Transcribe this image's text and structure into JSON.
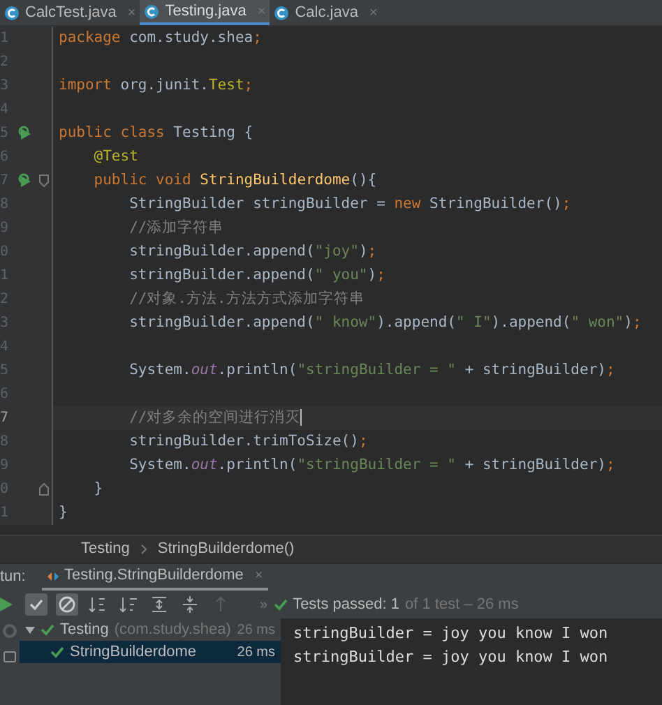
{
  "tabs": [
    {
      "label": "CalcTest.java",
      "close": "×",
      "selected": false
    },
    {
      "label": "Testing.java",
      "close": "×",
      "selected": true
    },
    {
      "label": "Calc.java",
      "close": "×",
      "selected": false
    }
  ],
  "editor": {
    "lines": [
      {
        "number": "1",
        "current": false,
        "run_marker": false,
        "fold_start": false,
        "fold_end": false,
        "tokens": [
          {
            "kind": "keyword",
            "text": "package"
          },
          {
            "kind": "plain",
            "text": " com.study.shea"
          },
          {
            "kind": "keyword",
            "text": ";"
          }
        ]
      },
      {
        "number": "2",
        "current": false,
        "run_marker": false,
        "fold_start": false,
        "fold_end": false
      },
      {
        "number": "3",
        "current": false,
        "run_marker": false,
        "fold_start": false,
        "fold_end": false,
        "tokens": [
          {
            "kind": "keyword",
            "text": "import"
          },
          {
            "kind": "plain",
            "text": " org.junit."
          },
          {
            "kind": "annotation",
            "text": "Test"
          },
          {
            "kind": "keyword",
            "text": ";"
          }
        ]
      },
      {
        "number": "4",
        "current": false,
        "run_marker": false,
        "fold_start": false,
        "fold_end": false
      },
      {
        "number": "5",
        "current": false,
        "run_marker": true,
        "fold_start": false,
        "fold_end": false,
        "tokens": [
          {
            "kind": "keyword",
            "text": "public class"
          },
          {
            "kind": "plain",
            "text": " Testing {"
          }
        ]
      },
      {
        "number": "6",
        "current": false,
        "run_marker": false,
        "fold_start": false,
        "fold_end": false,
        "tokens": [
          {
            "kind": "annotation",
            "text": "    @Test"
          }
        ]
      },
      {
        "number": "7",
        "current": false,
        "run_marker": true,
        "fold_start": true,
        "fold_end": false,
        "tokens": [
          {
            "kind": "keyword",
            "text": "    public void "
          },
          {
            "kind": "method",
            "text": "StringBuilderdome"
          },
          {
            "kind": "plain",
            "text": "(){"
          }
        ]
      },
      {
        "number": "8",
        "current": false,
        "run_marker": false,
        "fold_start": false,
        "fold_end": false,
        "tokens": [
          {
            "kind": "plain",
            "text": "        StringBuilder stringBuilder = "
          },
          {
            "kind": "keyword",
            "text": "new"
          },
          {
            "kind": "plain",
            "text": " StringBuilder()"
          },
          {
            "kind": "keyword",
            "text": ";"
          }
        ]
      },
      {
        "number": "9",
        "current": false,
        "run_marker": false,
        "fold_start": false,
        "fold_end": false,
        "tokens": [
          {
            "kind": "comment",
            "text": "        //添加字符串"
          }
        ]
      },
      {
        "number": "0",
        "current": false,
        "run_marker": false,
        "fold_start": false,
        "fold_end": false,
        "tokens": [
          {
            "kind": "plain",
            "text": "        stringBuilder.append("
          },
          {
            "kind": "string",
            "text": "\"joy\""
          },
          {
            "kind": "plain",
            "text": ")"
          },
          {
            "kind": "keyword",
            "text": ";"
          }
        ]
      },
      {
        "number": "1",
        "current": false,
        "run_marker": false,
        "fold_start": false,
        "fold_end": false,
        "tokens": [
          {
            "kind": "plain",
            "text": "        stringBuilder.append("
          },
          {
            "kind": "string",
            "text": "\" you\""
          },
          {
            "kind": "plain",
            "text": ")"
          },
          {
            "kind": "keyword",
            "text": ";"
          }
        ]
      },
      {
        "number": "2",
        "current": false,
        "run_marker": false,
        "fold_start": false,
        "fold_end": false,
        "tokens": [
          {
            "kind": "comment",
            "text": "        //对象.方法.方法方式添加字符串"
          }
        ]
      },
      {
        "number": "3",
        "current": false,
        "run_marker": false,
        "fold_start": false,
        "fold_end": false,
        "tokens": [
          {
            "kind": "plain",
            "text": "        stringBuilder.append("
          },
          {
            "kind": "string",
            "text": "\" know\""
          },
          {
            "kind": "plain",
            "text": ").append("
          },
          {
            "kind": "string",
            "text": "\" I\""
          },
          {
            "kind": "plain",
            "text": ").append("
          },
          {
            "kind": "string",
            "text": "\" won\""
          },
          {
            "kind": "plain",
            "text": ")"
          },
          {
            "kind": "keyword",
            "text": ";"
          }
        ]
      },
      {
        "number": "4",
        "current": false,
        "run_marker": false,
        "fold_start": false,
        "fold_end": false
      },
      {
        "number": "5",
        "current": false,
        "run_marker": false,
        "fold_start": false,
        "fold_end": false,
        "tokens": [
          {
            "kind": "plain",
            "text": "        System."
          },
          {
            "kind": "field",
            "text": "out"
          },
          {
            "kind": "plain",
            "text": ".println("
          },
          {
            "kind": "string",
            "text": "\"stringBuilder = \""
          },
          {
            "kind": "plain",
            "text": " + stringBuilder)"
          },
          {
            "kind": "keyword",
            "text": ";"
          }
        ]
      },
      {
        "number": "6",
        "current": false,
        "run_marker": false,
        "fold_start": false,
        "fold_end": false
      },
      {
        "number": "7",
        "current": true,
        "run_marker": false,
        "fold_start": false,
        "fold_end": false,
        "tokens": [
          {
            "kind": "comment",
            "text": "        //对多余的空间进行消灭"
          }
        ]
      },
      {
        "number": "8",
        "current": false,
        "run_marker": false,
        "fold_start": false,
        "fold_end": false,
        "tokens": [
          {
            "kind": "plain",
            "text": "        stringBuilder.trimToSize()"
          },
          {
            "kind": "keyword",
            "text": ";"
          }
        ]
      },
      {
        "number": "9",
        "current": false,
        "run_marker": false,
        "fold_start": false,
        "fold_end": false,
        "tokens": [
          {
            "kind": "plain",
            "text": "        System."
          },
          {
            "kind": "field",
            "text": "out"
          },
          {
            "kind": "plain",
            "text": ".println("
          },
          {
            "kind": "string",
            "text": "\"stringBuilder = \""
          },
          {
            "kind": "plain",
            "text": " + stringBuilder)"
          },
          {
            "kind": "keyword",
            "text": ";"
          }
        ]
      },
      {
        "number": "0",
        "current": false,
        "run_marker": false,
        "fold_start": false,
        "fold_end": true,
        "tokens": [
          {
            "kind": "plain",
            "text": "    }"
          }
        ]
      },
      {
        "number": "1",
        "current": false,
        "run_marker": false,
        "fold_start": false,
        "fold_end": false,
        "tokens": [
          {
            "kind": "plain",
            "text": "}"
          }
        ]
      }
    ]
  },
  "breadcrumb": [
    "Testing",
    "StringBuilderdome()"
  ],
  "run_panel": {
    "label": "tun:",
    "tab": {
      "label": "Testing.StringBuilderdome",
      "close": "×",
      "selected": true
    },
    "more": "»",
    "status": {
      "label": "Tests passed: 1",
      "detail": "of 1 test – 26 ms"
    },
    "tree": [
      {
        "name": "Testing",
        "package": "(com.study.shea)",
        "time": "26 ms",
        "expanded": true,
        "selected": false,
        "children": [
          {
            "name": "StringBuilderdome",
            "time": "26 ms",
            "selected": true
          }
        ]
      }
    ],
    "console": [
      "stringBuilder = joy you know I won",
      "stringBuilder = joy you know I won"
    ]
  }
}
